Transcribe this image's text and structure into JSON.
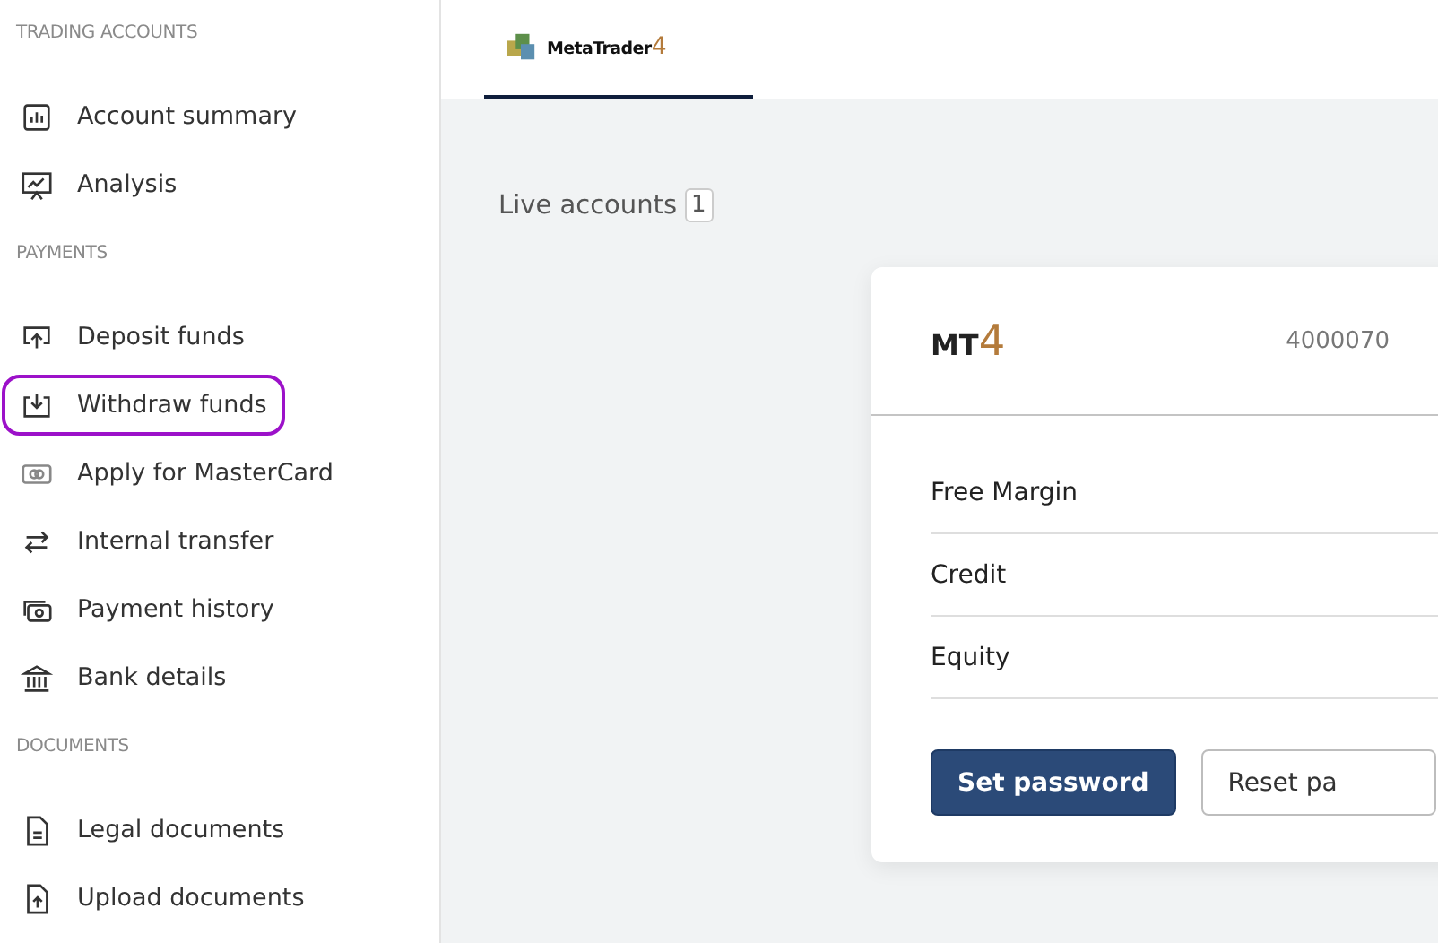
{
  "sidebar": {
    "sections": [
      {
        "heading": "TRADING ACCOUNTS",
        "items": [
          {
            "label": "Account summary",
            "kind": "bars",
            "highlighted": false
          },
          {
            "label": "Analysis",
            "kind": "presentation",
            "highlighted": false
          }
        ]
      },
      {
        "heading": "PAYMENTS",
        "items": [
          {
            "label": "Deposit funds",
            "kind": "upload",
            "highlighted": false
          },
          {
            "label": "Withdraw funds",
            "kind": "download",
            "highlighted": true
          },
          {
            "label": "Apply for MasterCard",
            "kind": "card",
            "highlighted": false
          },
          {
            "label": "Internal transfer",
            "kind": "arrows",
            "highlighted": false
          },
          {
            "label": "Payment history",
            "kind": "cash",
            "highlighted": false
          },
          {
            "label": "Bank details",
            "kind": "bank",
            "highlighted": false
          }
        ]
      },
      {
        "heading": "DOCUMENTS",
        "items": [
          {
            "label": "Legal documents",
            "kind": "document",
            "highlighted": false
          },
          {
            "label": "Upload documents",
            "kind": "updoc",
            "highlighted": false
          }
        ]
      }
    ]
  },
  "tabs": [
    {
      "label": "MetaTrader",
      "suffix": "4",
      "selected": true
    }
  ],
  "live_accounts": {
    "label": "Live accounts",
    "count": "1"
  },
  "account_card": {
    "platform": "MT",
    "platform_suffix": "4",
    "number": "4000070",
    "rows": [
      "Free Margin",
      "Credit",
      "Equity"
    ],
    "buttons": [
      {
        "label": "Set password",
        "kind": "primary"
      },
      {
        "label": "Reset pa",
        "kind": "secondary"
      }
    ]
  }
}
